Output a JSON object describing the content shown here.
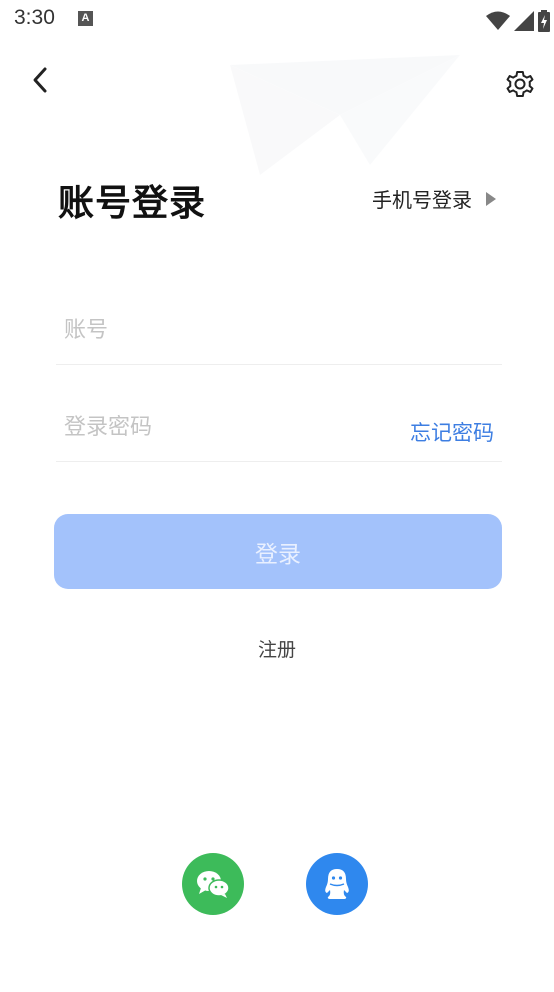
{
  "status_bar": {
    "time": "3:30",
    "notification_icon": "A",
    "icons": [
      "wifi-icon",
      "cellular-signal-icon",
      "battery-charging-icon"
    ]
  },
  "header": {
    "back_icon": "chevron-left-icon",
    "settings_icon": "gear-icon"
  },
  "title": "账号登录",
  "phone_login": {
    "label": "手机号登录",
    "icon": "triangle-right-icon"
  },
  "form": {
    "account_placeholder": "账号",
    "account_value": "",
    "password_placeholder": "登录密码",
    "password_value": "",
    "forgot_label": "忘记密码"
  },
  "login_button_label": "登录",
  "register_label": "注册",
  "social": [
    {
      "name": "wechat",
      "icon": "wechat-icon",
      "color": "#3dbb5a"
    },
    {
      "name": "qq",
      "icon": "qq-icon",
      "color": "#2f88ee"
    }
  ],
  "colors": {
    "accent": "#3d7ee2",
    "login_button_disabled": "#a3c2fb",
    "placeholder": "#c4c4c4"
  }
}
